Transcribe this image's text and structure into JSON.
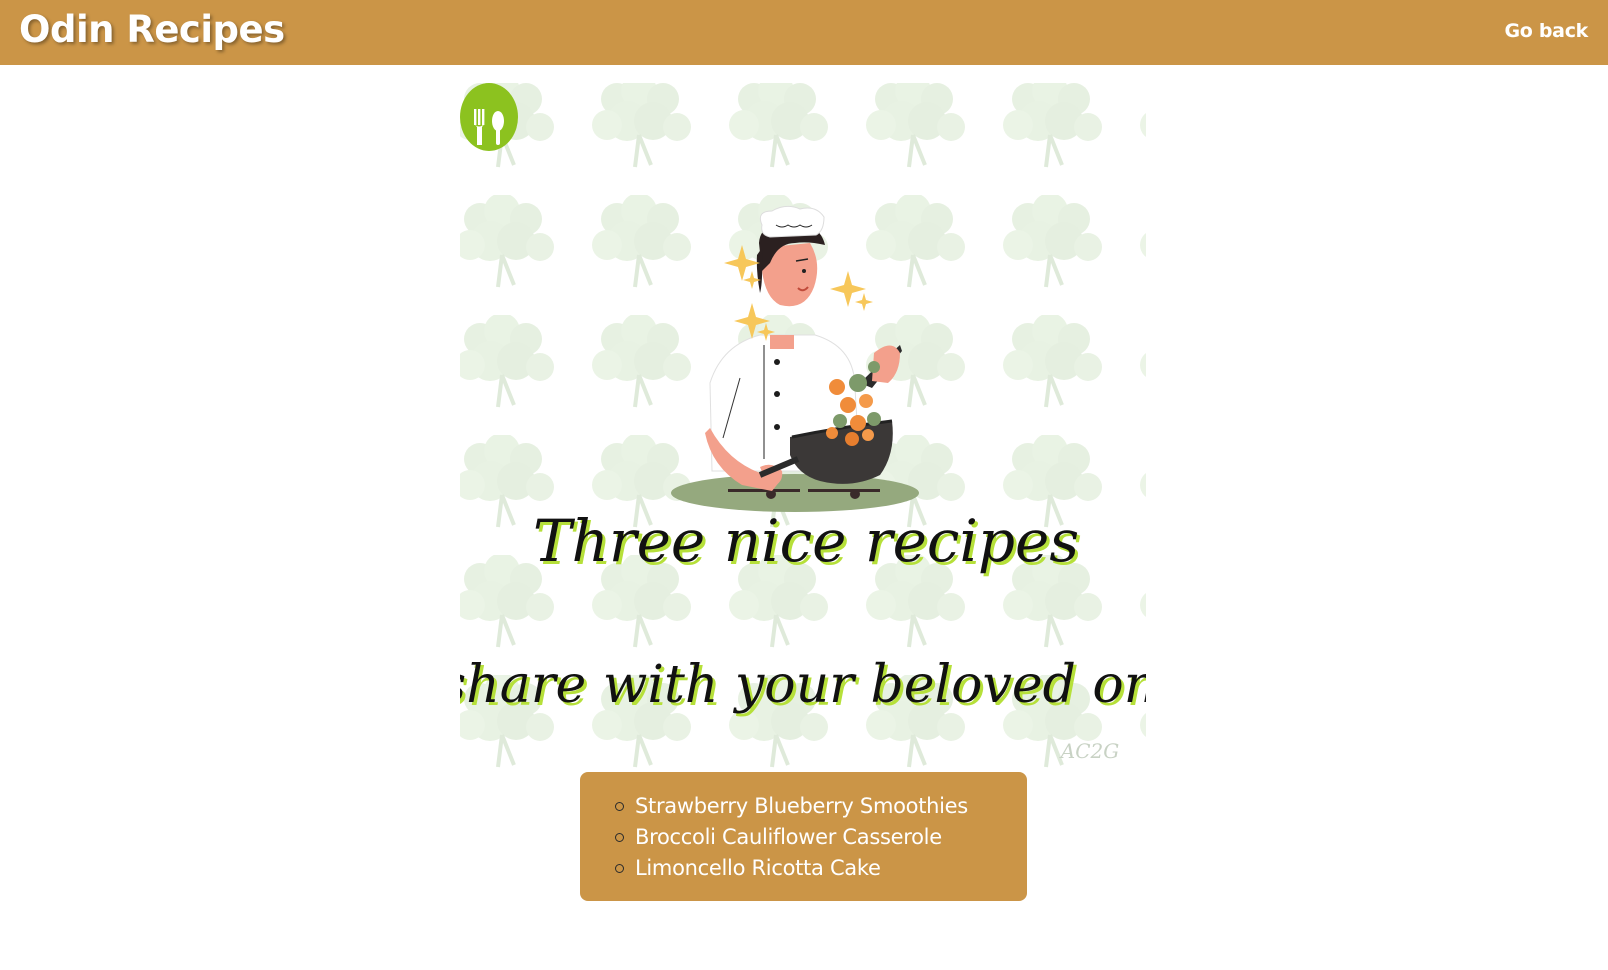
{
  "header": {
    "title": "Odin Recipes",
    "back_link": "Go back"
  },
  "poster": {
    "headline_line1": "Three nice recipes",
    "headline_line2": "to share with your beloved ones.",
    "signature": "AC2G",
    "logo_icon": "fork-spoon-icon",
    "illustration": "chef-cooking-wok-illustration",
    "pattern": "broccoli-pattern"
  },
  "recipes": {
    "items": [
      "Strawberry Blueberry Smoothies",
      "Broccoli Cauliflower Casserole",
      "Limoncello Ricotta Cake"
    ]
  },
  "colors": {
    "brand": "#cb9547",
    "logo_green": "#8cc21f",
    "headline_shadow": "#b6e03a"
  }
}
